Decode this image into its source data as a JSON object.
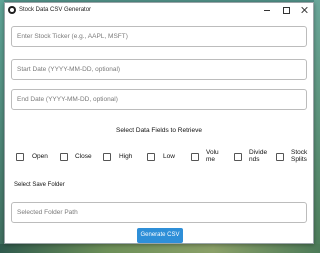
{
  "window": {
    "title": "Stock Data CSV Generator"
  },
  "inputs": {
    "ticker_placeholder": "Enter Stock Ticker (e.g., AAPL, MSFT)",
    "start_date_placeholder": "Start Date (YYYY-MM-DD, optional)",
    "end_date_placeholder": "End Date (YYYY-MM-DD, optional)",
    "folder_placeholder": "Selected Folder Path"
  },
  "fields_section": {
    "title": "Select Data Fields to Retrieve",
    "options": [
      {
        "label": "Open",
        "checked": false
      },
      {
        "label": "Close",
        "checked": false
      },
      {
        "label": "High",
        "checked": false
      },
      {
        "label": "Low",
        "checked": false
      },
      {
        "label": "Volu\nme",
        "checked": false
      },
      {
        "label": "Divide\nnds",
        "checked": false
      },
      {
        "label": "Stock\nSplits",
        "checked": false
      }
    ]
  },
  "save": {
    "label": "Select Save Folder"
  },
  "actions": {
    "generate_label": "Generate CSV"
  }
}
